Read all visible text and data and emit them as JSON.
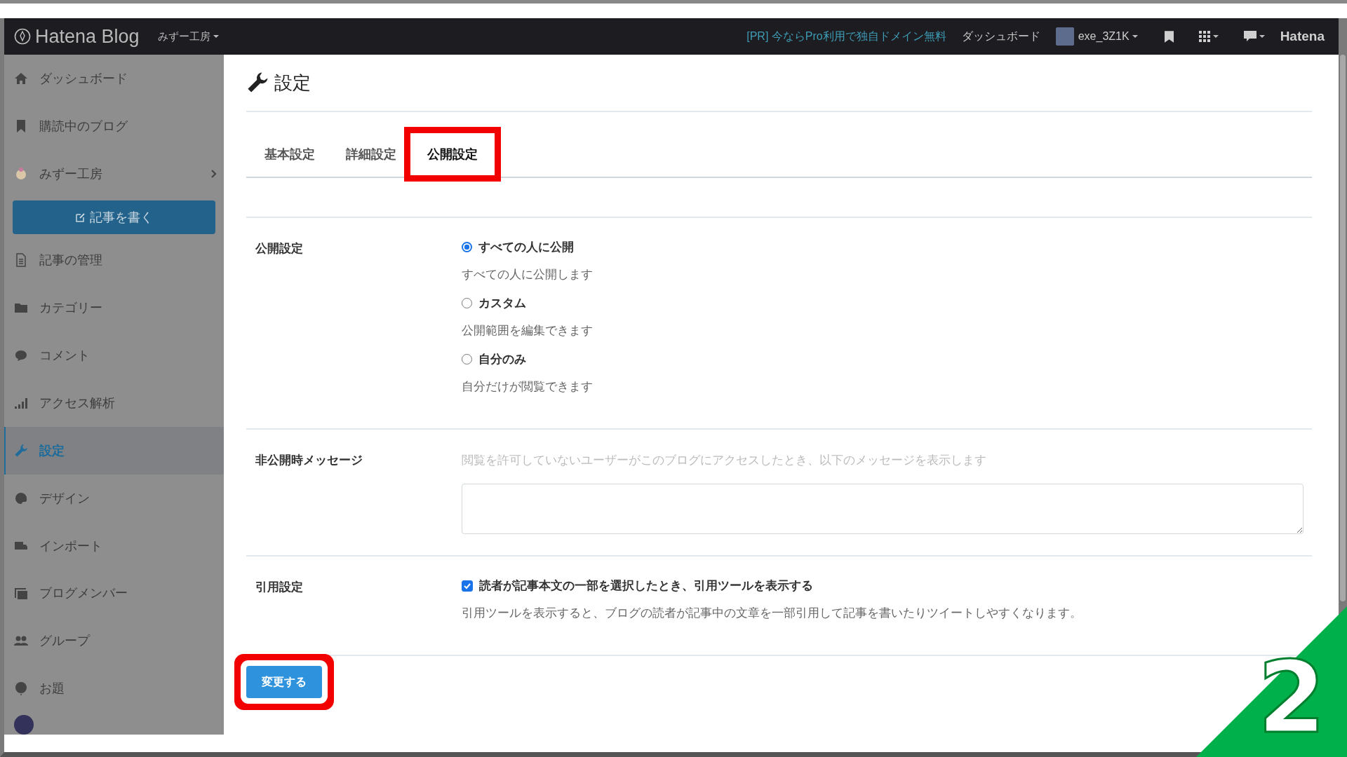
{
  "header": {
    "logo": "Hatena Blog",
    "blog_menu": "みずー工房",
    "promo_link": "[PR] 今ならPro利用で独自ドメイン無料",
    "dashboard_link": "ダッシュボード",
    "user": "exe_3Z1K",
    "brand": "Hatena"
  },
  "sidebar": {
    "items": [
      {
        "kind": "link",
        "label": "ダッシュボード",
        "selected": false
      },
      {
        "kind": "link",
        "label": "購読中のブログ",
        "selected": false
      },
      {
        "kind": "blog",
        "label": "みずー工房",
        "selected": false
      },
      {
        "kind": "button",
        "label": "記事を書く"
      },
      {
        "kind": "link",
        "label": "記事の管理",
        "selected": false
      },
      {
        "kind": "link",
        "label": "カテゴリー",
        "selected": false
      },
      {
        "kind": "link",
        "label": "コメント",
        "selected": false
      },
      {
        "kind": "link",
        "label": "アクセス解析",
        "selected": false
      },
      {
        "kind": "link",
        "label": "設定",
        "selected": true
      },
      {
        "kind": "link",
        "label": "デザイン",
        "selected": false
      },
      {
        "kind": "link",
        "label": "インポート",
        "selected": false
      },
      {
        "kind": "link",
        "label": "ブログメンバー",
        "selected": false
      },
      {
        "kind": "link",
        "label": "グループ",
        "selected": false
      },
      {
        "kind": "link",
        "label": "お題",
        "selected": false
      }
    ]
  },
  "page": {
    "title": "設定"
  },
  "tabs": [
    {
      "label": "基本設定",
      "selected": false,
      "highlighted": false
    },
    {
      "label": "詳細設定",
      "selected": false,
      "highlighted": false
    },
    {
      "label": "公開設定",
      "selected": true,
      "highlighted": true
    }
  ],
  "visibility": {
    "label": "公開設定",
    "options": [
      {
        "label": "すべての人に公開",
        "description": "すべての人に公開します",
        "selected": true
      },
      {
        "label": "カスタム",
        "description": "公開範囲を編集できます",
        "selected": false
      },
      {
        "label": "自分のみ",
        "description": "自分だけが閲覧できます",
        "selected": false
      }
    ]
  },
  "private_message": {
    "label": "非公開時メッセージ",
    "hint": "閲覧を許可していないユーザーがこのブログにアクセスしたとき、以下のメッセージを表示します"
  },
  "quote": {
    "label": "引用設定",
    "option": "読者が記事本文の一部を選択したとき、引用ツールを表示する",
    "checked": true,
    "description": "引用ツールを表示すると、ブログの読者が記事中の文章を一部引用して記事を書いたりツイートしやすくなります。"
  },
  "submit": {
    "label": "変更する",
    "highlighted": true
  },
  "step_badge": "2"
}
